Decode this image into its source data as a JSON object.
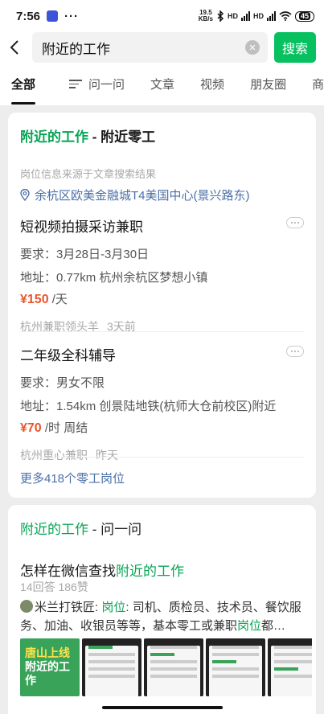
{
  "status": {
    "time": "7:56",
    "dots": "···",
    "net_speed": "19.5",
    "net_unit": "KB/s",
    "hd1": "HD",
    "hd2": "HD",
    "battery": "45"
  },
  "search": {
    "query": "附近的工作",
    "button": "搜索"
  },
  "tabs": [
    "全部",
    "问一问",
    "文章",
    "视频",
    "朋友圈",
    "商品"
  ],
  "card1": {
    "title_green": "附近的工作",
    "title_rest": " - 附近零工",
    "source_note": "岗位信息来源于文章搜索结果",
    "location": "余杭区欧美金融城T4美国中心(景兴路东)",
    "jobs": [
      {
        "title": "短视频拍摄采访兼职",
        "requirement": "要求：3月28日-3月30日",
        "address": "地址：0.77km 杭州余杭区梦想小镇",
        "salary_num": "¥150",
        "salary_unit": " /天",
        "salary_extra": "",
        "poster": "杭州兼职领头羊",
        "time": "3天前"
      },
      {
        "title": "二年级全科辅导",
        "requirement": "要求：男女不限",
        "address": "地址：1.54km 创景陆地铁(杭师大仓前校区)附近",
        "salary_num": "¥70",
        "salary_unit": " /时",
        "salary_extra": "  周结",
        "poster": "杭州重心兼职",
        "time": "昨天"
      }
    ],
    "more_link": "更多418个零工岗位"
  },
  "card2": {
    "title_green": "附近的工作",
    "title_rest": " - 问一问",
    "question_prefix": "怎样在微信查找",
    "question_green": "附近的工作",
    "stats": "14回答 186赞",
    "answer_author": "米兰打铁匠: ",
    "answer_kw1": "岗位",
    "answer_mid": ": 司机、质检员、技术员、餐饮服务、加油、收银员等等，基本零工或兼职",
    "answer_kw2": "岗位",
    "answer_end": "都…",
    "thumb1_tag": "唐山上线",
    "thumb1_line": "附近的工作"
  }
}
